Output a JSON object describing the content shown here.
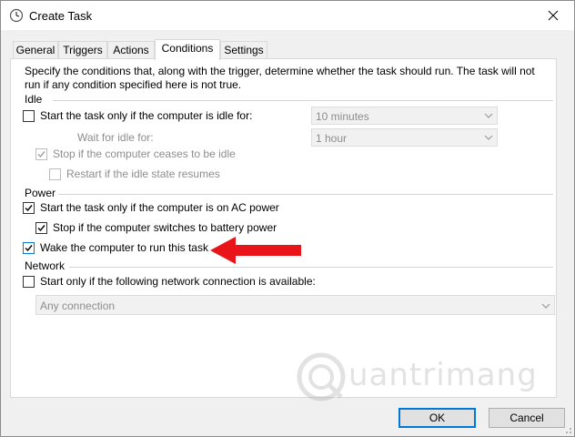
{
  "window": {
    "title": "Create Task",
    "app_icon": "clock-icon",
    "close_icon": "close-icon"
  },
  "tabs": [
    {
      "label": "General",
      "active": false
    },
    {
      "label": "Triggers",
      "active": false
    },
    {
      "label": "Actions",
      "active": false
    },
    {
      "label": "Conditions",
      "active": true
    },
    {
      "label": "Settings",
      "active": false
    }
  ],
  "conditions": {
    "intro": "Specify the conditions that, along with the trigger, determine whether the task should run.  The task will not run  if any condition specified here is not true.",
    "idle": {
      "title": "Idle",
      "start_if_idle": {
        "label": "Start the task only if the computer is idle for:",
        "checked": false
      },
      "idle_for_value": "10 minutes",
      "wait_label": "Wait for idle for:",
      "wait_value": "1 hour",
      "stop_if_ceases": {
        "label": "Stop if the computer ceases to be idle",
        "checked": true,
        "disabled": true
      },
      "restart_if_resumes": {
        "label": "Restart if the idle state resumes",
        "checked": false,
        "disabled": true
      }
    },
    "power": {
      "title": "Power",
      "ac_power": {
        "label": "Start the task only if the computer is on AC power",
        "checked": true
      },
      "battery_stop": {
        "label": "Stop if the computer switches to battery power",
        "checked": true
      },
      "wake": {
        "label": "Wake the computer to run this task",
        "checked": true
      }
    },
    "network": {
      "title": "Network",
      "start_if_network": {
        "label": "Start only if the following network connection is available:",
        "checked": false
      },
      "connection_value": "Any connection"
    }
  },
  "buttons": {
    "ok": "OK",
    "cancel": "Cancel"
  },
  "annotation": {
    "arrow_icon": "red-arrow-icon",
    "arrow_color": "#e8141a"
  },
  "watermark": {
    "text": "uantrimang",
    "logo_icon": "quantrimang-logo-icon"
  },
  "colors": {
    "accent": "#0078d7",
    "window_bg": "#f0f0f0",
    "panel_bg": "#ffffff",
    "disabled_text": "#8d8d8d"
  }
}
